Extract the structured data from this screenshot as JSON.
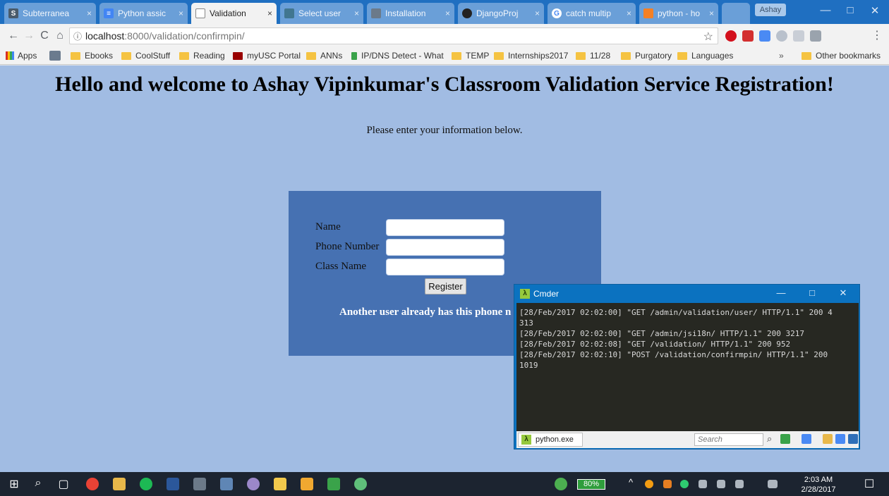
{
  "browser": {
    "tabs": [
      {
        "title": "Subterranea",
        "favicon_text": "S",
        "favicon_color": "#4a5b6b"
      },
      {
        "title": "Python assic",
        "favicon_text": "≡",
        "favicon_color": "#4285f4"
      },
      {
        "title": "Validation",
        "favicon_text": "",
        "favicon_color": "#ffffff"
      },
      {
        "title": "Select user",
        "favicon_text": "",
        "favicon_color": "#417690"
      },
      {
        "title": "Installation",
        "favicon_text": "",
        "favicon_color": "#6b7a8a"
      },
      {
        "title": "DjangoProj",
        "favicon_text": "",
        "favicon_color": "#222222"
      },
      {
        "title": "catch multip",
        "favicon_text": "G",
        "favicon_color": "#ffffff"
      },
      {
        "title": "python - ho",
        "favicon_text": "",
        "favicon_color": "#f48024"
      }
    ],
    "close_glyph": "×",
    "profile": "Ashay",
    "window_controls": {
      "minimize": "—",
      "maximize": "□",
      "close": "✕"
    },
    "nav": {
      "back": "←",
      "forward": "→",
      "reload": "C",
      "home": "⌂"
    },
    "url": {
      "info_glyph": "ⓘ",
      "host": "localhost",
      "path": ":8000/validation/confirmpin/"
    },
    "bookmark_star": "☆",
    "bookmarks": [
      {
        "label": "Apps"
      },
      {
        "label": ""
      },
      {
        "label": "Ebooks"
      },
      {
        "label": "CoolStuff"
      },
      {
        "label": "Reading"
      },
      {
        "label": "myUSC Portal"
      },
      {
        "label": "ANNs"
      },
      {
        "label": "IP/DNS Detect - What"
      },
      {
        "label": "TEMP"
      },
      {
        "label": "Internships2017"
      },
      {
        "label": "11/28"
      },
      {
        "label": "Purgatory"
      },
      {
        "label": "Languages"
      }
    ],
    "bookmarks_overflow": "»",
    "other_bookmarks": "Other bookmarks"
  },
  "page": {
    "heading": "Hello and welcome to Ashay Vipinkumar's Classroom Validation Service Registration!",
    "intro": "Please enter your information below.",
    "form": {
      "fields": [
        {
          "label": "Name",
          "value": ""
        },
        {
          "label": "Phone Number",
          "value": ""
        },
        {
          "label": "Class Name",
          "value": ""
        }
      ],
      "submit_label": "Register",
      "error": "Another user already has this phone n"
    }
  },
  "cmder": {
    "title": "Cmder",
    "logo_glyph": "λ",
    "log_lines": [
      "[28/Feb/2017 02:02:00] \"GET /admin/validation/user/ HTTP/1.1\" 200 4",
      "313",
      "[28/Feb/2017 02:02:00] \"GET /admin/jsi18n/ HTTP/1.1\" 200 3217",
      "[28/Feb/2017 02:02:08] \"GET /validation/ HTTP/1.1\" 200 952",
      "[28/Feb/2017 02:02:10] \"POST /validation/confirmpin/ HTTP/1.1\" 200",
      "1019"
    ],
    "process_tab": "python.exe",
    "search_placeholder": "Search",
    "search_glyph": "⌕"
  },
  "taskbar": {
    "start_glyph": "⊞",
    "search_glyph": "⌕",
    "task_view_glyph": "▢",
    "battery": "80%",
    "tray_arrow": "^",
    "time": "2:03 AM",
    "date": "2/28/2017",
    "notification_glyph": "☐"
  },
  "colors": {
    "page_background": "#a1bce3",
    "form_panel": "#4671b2",
    "chrome_frame": "#1f6fc1",
    "console_background": "#272822"
  }
}
